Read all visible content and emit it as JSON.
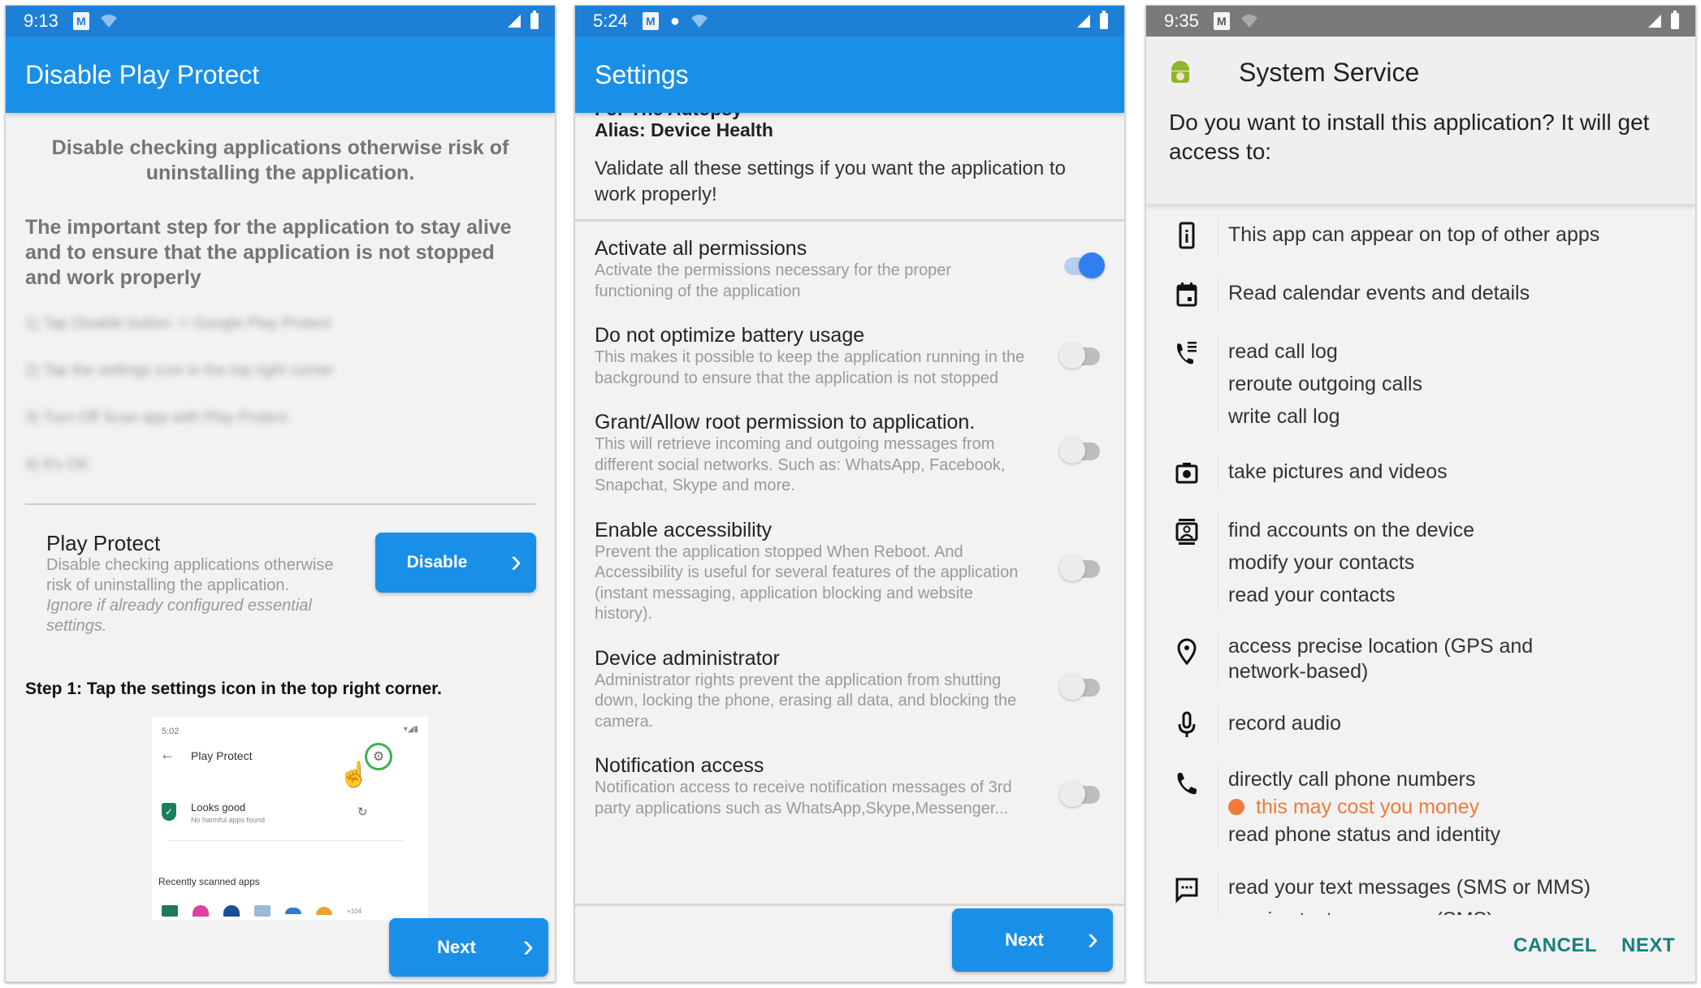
{
  "panel1": {
    "status": {
      "time": "9:13"
    },
    "title": "Disable Play Protect",
    "lead": "Disable checking applications otherwise risk of uninstalling the application.",
    "important": "The important step for the application to stay alive and to ensure that the application is not stopped and work properly",
    "blurred_steps": [
      "1) Tap Disable button -> Google Play Protect",
      "2) Tap the settings icon in the top right corner",
      "3) Turn Off Scan app with Play Protect",
      "4) It's OK"
    ],
    "play_protect": {
      "title": "Play Protect",
      "desc": "Disable checking applications otherwise risk of uninstalling the application.",
      "note": "Ignore if already configured essential settings.",
      "button": "Disable"
    },
    "step1": "Step 1: Tap the settings icon in the top right corner.",
    "illustration": {
      "time": "5:02",
      "title": "Play Protect",
      "status_title": "Looks good",
      "status_sub": "No harmful apps found",
      "recent": "Recently scanned apps",
      "more": "+104"
    },
    "next": "Next"
  },
  "panel2": {
    "status": {
      "time": "5:24"
    },
    "title": "Settings",
    "cut_text": "For The Autopsy",
    "alias": "Alias: Device Health",
    "validate": "Validate all these settings if you want the application to work properly!",
    "settings": [
      {
        "title": "Activate all permissions",
        "desc": "Activate the permissions necessary for the proper functioning of the application",
        "on": true
      },
      {
        "title": "Do not optimize battery usage",
        "desc": "This makes it possible to keep the application running in the background to ensure that the application is not stopped",
        "on": false
      },
      {
        "title": "Grant/Allow root permission to application.",
        "desc": "This will retrieve incoming and outgoing messages from different social networks. Such as: WhatsApp, Facebook, Snapchat, Skype and more.",
        "on": false
      },
      {
        "title": "Enable accessibility",
        "desc": "Prevent the application stopped When Reboot. And Accessibility is useful for several features of the application (instant messaging, application blocking and website history).",
        "on": false
      },
      {
        "title": "Device administrator",
        "desc": "Administrator rights prevent the application from shutting down, locking the phone, erasing all data, and blocking the camera.",
        "on": false
      },
      {
        "title": "Notification access",
        "desc": "Notification access to receive notification messages of 3rd party applications such as WhatsApp,Skype,Messenger...",
        "on": false
      }
    ],
    "next": "Next"
  },
  "panel3": {
    "status": {
      "time": "9:35"
    },
    "title": "System Service",
    "question": "Do you want to install this application? It will get access to:",
    "permissions": [
      {
        "icon": "overlay",
        "lines": [
          "This app can appear on top of other apps"
        ]
      },
      {
        "icon": "calendar",
        "lines": [
          "Read calendar events and details"
        ]
      },
      {
        "icon": "call-log",
        "lines": [
          "read call log",
          "reroute outgoing calls",
          "write call log"
        ]
      },
      {
        "icon": "camera",
        "lines": [
          "take pictures and videos"
        ]
      },
      {
        "icon": "contacts",
        "lines": [
          "find accounts on the device",
          "modify your contacts",
          "read your contacts"
        ]
      },
      {
        "icon": "location",
        "lines": [
          "access precise location (GPS and network-based)"
        ]
      },
      {
        "icon": "microphone",
        "lines": [
          "record audio"
        ]
      },
      {
        "icon": "phone",
        "lines": [
          "directly call phone numbers",
          "read phone status and identity"
        ],
        "warning": "this may cost you money"
      },
      {
        "icon": "sms",
        "lines": [
          "read your text messages (SMS or MMS)",
          "receive text messages (SMS)"
        ]
      }
    ],
    "cancel": "CANCEL",
    "next": "NEXT",
    "colors": {
      "warning": "#f07a3c",
      "dialog_button": "#177e7e"
    }
  },
  "colors": {
    "appbar": "#1a8fe8",
    "statusbar_blue": "#1e7fd6",
    "statusbar_gray": "#7a7a7a",
    "toggle_on": "#2f7ff0"
  }
}
